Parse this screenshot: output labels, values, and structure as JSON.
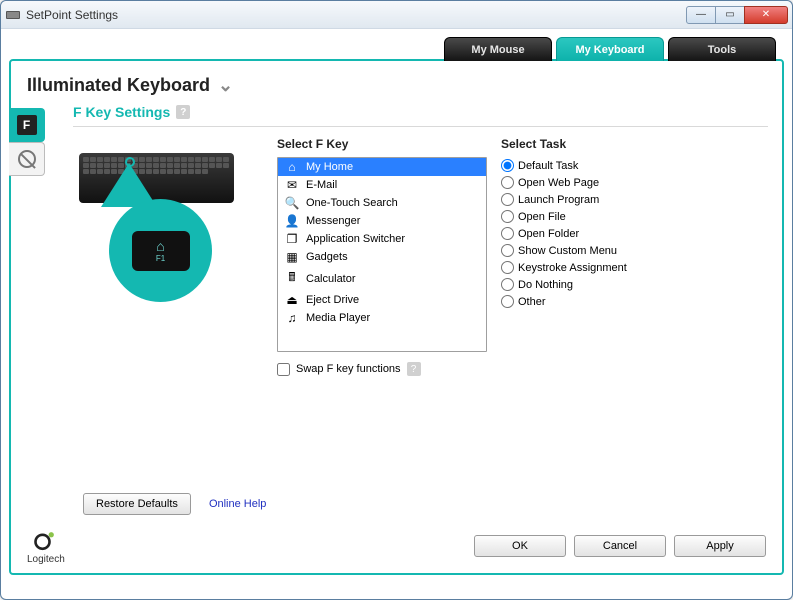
{
  "window": {
    "title": "SetPoint Settings"
  },
  "tabs": {
    "mouse": "My Mouse",
    "keyboard": "My Keyboard",
    "tools": "Tools"
  },
  "device": {
    "name": "Illuminated Keyboard"
  },
  "section": {
    "title": "F Key Settings"
  },
  "fkey": {
    "heading": "Select F Key",
    "items": [
      {
        "icon": "home-icon",
        "glyph": "⌂",
        "label": "My Home"
      },
      {
        "icon": "mail-icon",
        "glyph": "✉",
        "label": "E-Mail"
      },
      {
        "icon": "search-icon",
        "glyph": "🔍",
        "label": "One-Touch Search"
      },
      {
        "icon": "messenger-icon",
        "glyph": "👤",
        "label": "Messenger"
      },
      {
        "icon": "switcher-icon",
        "glyph": "❐",
        "label": "Application Switcher"
      },
      {
        "icon": "gadgets-icon",
        "glyph": "▦",
        "label": "Gadgets"
      },
      {
        "icon": "calculator-icon",
        "glyph": "🖩",
        "label": "Calculator"
      },
      {
        "icon": "eject-icon",
        "glyph": "⏏",
        "label": "Eject Drive"
      },
      {
        "icon": "media-icon",
        "glyph": "♫",
        "label": "Media Player"
      }
    ],
    "selected_index": 0,
    "swap_label": "Swap F key functions",
    "swap_checked": false,
    "zoom_key": "F1"
  },
  "task": {
    "heading": "Select Task",
    "items": [
      "Default Task",
      "Open Web Page",
      "Launch Program",
      "Open File",
      "Open Folder",
      "Show Custom Menu",
      "Keystroke Assignment",
      "Do Nothing",
      "Other"
    ],
    "selected_index": 0
  },
  "footer": {
    "restore": "Restore Defaults",
    "help": "Online Help",
    "ok": "OK",
    "cancel": "Cancel",
    "apply": "Apply",
    "brand": "Logitech"
  }
}
